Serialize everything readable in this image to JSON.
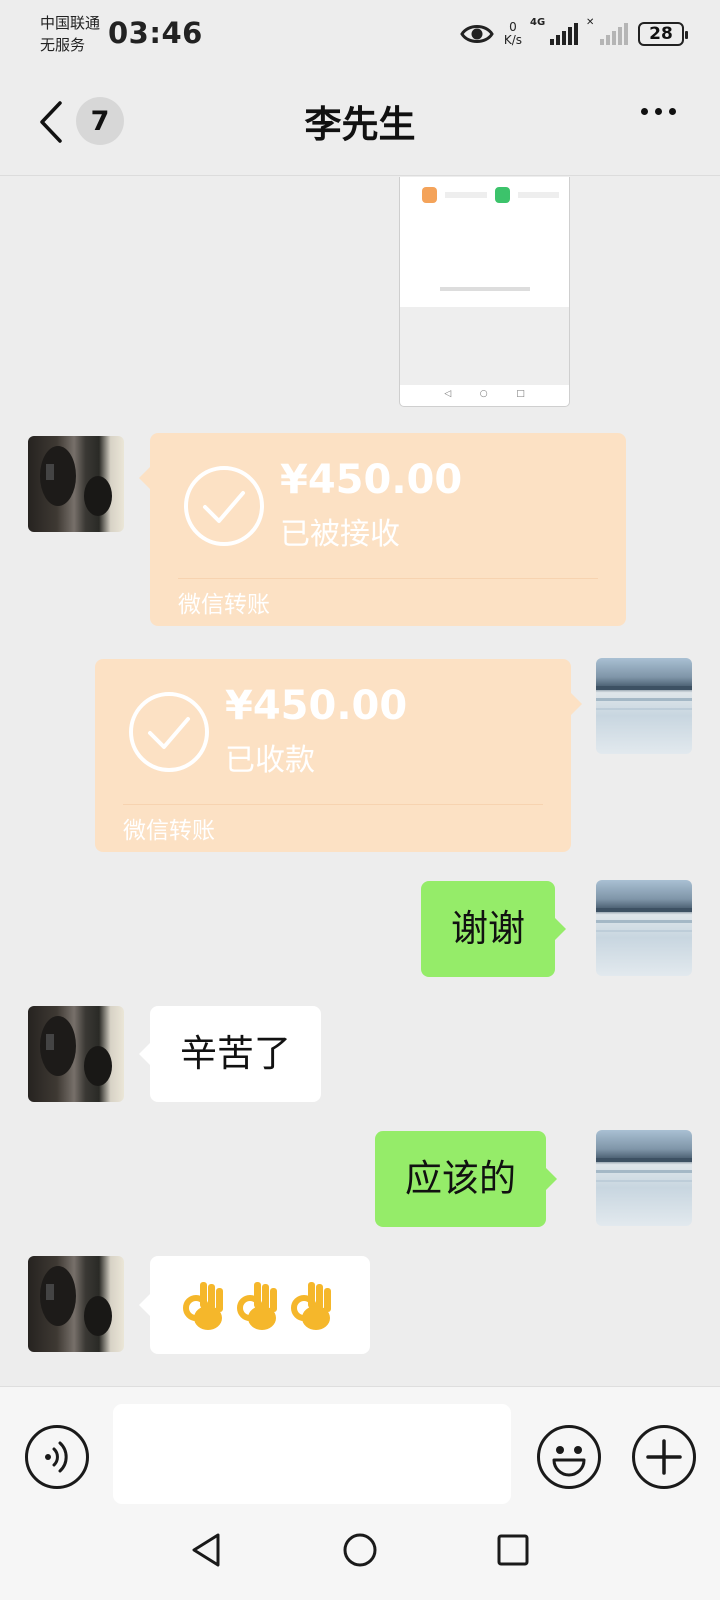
{
  "status_bar": {
    "carrier_line1": "中国联通",
    "carrier_line2": "无服务",
    "time": "03:46",
    "net_speed_value": "0",
    "net_speed_unit": "K/s",
    "network_type": "4G",
    "battery": "28",
    "icons": [
      "eye-icon",
      "signal-4g-icon",
      "signal-no-sim-icon",
      "battery-icon"
    ]
  },
  "header": {
    "unread_count": "7",
    "title": "李先生",
    "icons": [
      "back-arrow-icon",
      "more-dots-icon"
    ]
  },
  "messages": [
    {
      "type": "image",
      "side": "right",
      "content": "shared-screenshot"
    },
    {
      "type": "transfer",
      "side": "left",
      "amount": "¥450.00",
      "status": "已被接收",
      "brand": "微信转账"
    },
    {
      "type": "transfer",
      "side": "right",
      "amount": "¥450.00",
      "status": "已收款",
      "brand": "微信转账"
    },
    {
      "type": "text",
      "side": "right",
      "text": "谢谢"
    },
    {
      "type": "text",
      "side": "left",
      "text": "辛苦了"
    },
    {
      "type": "text",
      "side": "right",
      "text": "应该的"
    },
    {
      "type": "emoji",
      "side": "left",
      "emoji": "👌👌👌"
    }
  ],
  "input_bar": {
    "placeholder": "",
    "icons": [
      "voice-icon",
      "emoji-face-icon",
      "plus-icon"
    ]
  },
  "system_nav": {
    "icons": [
      "nav-back-triangle-icon",
      "nav-home-circle-icon",
      "nav-recents-square-icon"
    ]
  },
  "colors": {
    "background": "#ededed",
    "sent_bubble": "#95ec69",
    "received_bubble": "#ffffff",
    "transfer_bubble": "#fce1c4"
  }
}
